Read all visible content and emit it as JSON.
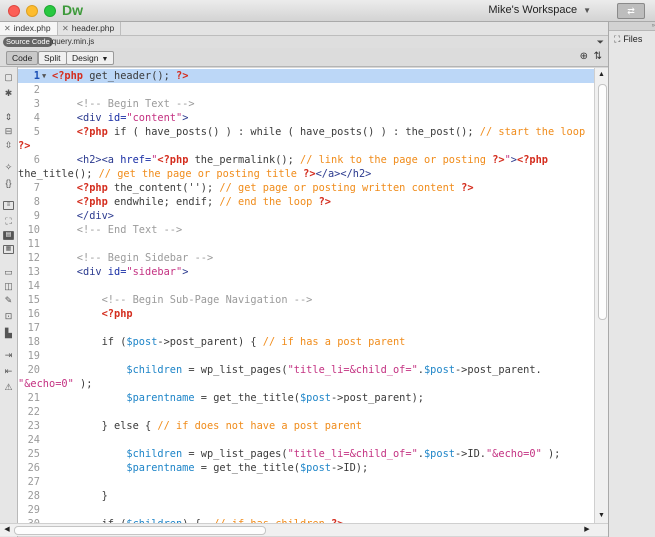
{
  "app": {
    "logo": "Dw",
    "workspace": "Mike's Workspace",
    "workspace_btn": "⇄"
  },
  "tabs": [
    {
      "label": "index.php",
      "active": true
    },
    {
      "label": "header.php",
      "active": false
    }
  ],
  "related": {
    "source_label": "Source Code",
    "file": "jquery.min.js"
  },
  "modes": {
    "code": "Code",
    "split": "Split",
    "design": "Design"
  },
  "panel": {
    "files": "Files"
  },
  "colors": {
    "php_tag": "#d42d1e",
    "comment": "#f08c1b",
    "html_comment": "#9b9b9b",
    "tag": "#2b3a8f",
    "string": "#c43282",
    "variable": "#1e85c8",
    "selection": "#bcd7f7"
  },
  "code_lines": [
    {
      "n": "1",
      "cur": true,
      "fold": "▼",
      "parts": [
        [
          "k",
          "<?php "
        ],
        [
          "f",
          "get_header(); "
        ],
        [
          "k",
          "?>"
        ]
      ]
    },
    {
      "n": "2",
      "parts": []
    },
    {
      "n": "3",
      "parts": [
        [
          "h",
          "    <!-- Begin Text -->"
        ]
      ]
    },
    {
      "n": "4",
      "parts": [
        [
          "t",
          "    <div "
        ],
        [
          "a",
          "id="
        ],
        [
          "st",
          "\"content\""
        ],
        [
          "t",
          ">"
        ]
      ]
    },
    {
      "n": "5",
      "parts": [
        [
          "k",
          "    <?php "
        ],
        [
          "f",
          "if ( have_posts() ) : while ( have_posts() ) : the_post(); "
        ],
        [
          "c",
          "// start the loop"
        ]
      ]
    },
    {
      "n": "",
      "wrap": true,
      "parts": [
        [
          "k",
          "?>"
        ]
      ]
    },
    {
      "n": "6",
      "parts": [
        [
          "t",
          "    <h2><a "
        ],
        [
          "a",
          "href="
        ],
        [
          "st",
          "\""
        ],
        [
          "k",
          "<?php "
        ],
        [
          "f",
          "the_permalink(); "
        ],
        [
          "c",
          "// link to the page or posting "
        ],
        [
          "k",
          "?>"
        ],
        [
          "st",
          "\""
        ],
        [
          "t",
          ">"
        ],
        [
          "k",
          "<?php"
        ]
      ]
    },
    {
      "n": "",
      "wrap": true,
      "parts": [
        [
          "f",
          "the_title(); "
        ],
        [
          "c",
          "// get the page or posting title "
        ],
        [
          "k",
          "?>"
        ],
        [
          "t",
          "</a></h2>"
        ]
      ]
    },
    {
      "n": "7",
      "parts": [
        [
          "k",
          "    <?php "
        ],
        [
          "f",
          "the_content(''); "
        ],
        [
          "c",
          "// get page or posting written content "
        ],
        [
          "k",
          "?>"
        ]
      ]
    },
    {
      "n": "8",
      "parts": [
        [
          "k",
          "    <?php "
        ],
        [
          "f",
          "endwhile; endif; "
        ],
        [
          "c",
          "// end the loop "
        ],
        [
          "k",
          "?>"
        ]
      ]
    },
    {
      "n": "9",
      "parts": [
        [
          "t",
          "    </div>"
        ]
      ]
    },
    {
      "n": "10",
      "parts": [
        [
          "h",
          "    <!-- End Text -->"
        ]
      ]
    },
    {
      "n": "11",
      "parts": []
    },
    {
      "n": "12",
      "parts": [
        [
          "h",
          "    <!-- Begin Sidebar -->"
        ]
      ]
    },
    {
      "n": "13",
      "parts": [
        [
          "t",
          "    <div "
        ],
        [
          "a",
          "id="
        ],
        [
          "st",
          "\"sidebar\""
        ],
        [
          "t",
          ">"
        ]
      ]
    },
    {
      "n": "14",
      "parts": []
    },
    {
      "n": "15",
      "parts": [
        [
          "h",
          "        <!-- Begin Sub-Page Navigation -->"
        ]
      ]
    },
    {
      "n": "16",
      "parts": [
        [
          "k",
          "        <?php"
        ]
      ]
    },
    {
      "n": "17",
      "parts": []
    },
    {
      "n": "18",
      "parts": [
        [
          "f",
          "        if ("
        ],
        [
          "v",
          "$post"
        ],
        [
          "f",
          "->post_parent) { "
        ],
        [
          "c",
          "// if has a post parent"
        ]
      ]
    },
    {
      "n": "19",
      "parts": []
    },
    {
      "n": "20",
      "parts": [
        [
          "v",
          "            $children"
        ],
        [
          "f",
          " = wp_list_pages("
        ],
        [
          "st",
          "\"title_li=&child_of=\""
        ],
        [
          "f",
          "."
        ],
        [
          "v",
          "$post"
        ],
        [
          "f",
          "->post_parent."
        ]
      ]
    },
    {
      "n": "",
      "wrap": true,
      "parts": [
        [
          "st",
          "\"&echo=0\""
        ],
        [
          "f",
          " );"
        ]
      ]
    },
    {
      "n": "21",
      "parts": [
        [
          "v",
          "            $parentname"
        ],
        [
          "f",
          " = get_the_title("
        ],
        [
          "v",
          "$post"
        ],
        [
          "f",
          "->post_parent);"
        ]
      ]
    },
    {
      "n": "22",
      "parts": []
    },
    {
      "n": "23",
      "parts": [
        [
          "f",
          "        } else { "
        ],
        [
          "c",
          "// if does not have a post parent"
        ]
      ]
    },
    {
      "n": "24",
      "parts": []
    },
    {
      "n": "25",
      "parts": [
        [
          "v",
          "            $children"
        ],
        [
          "f",
          " = wp_list_pages("
        ],
        [
          "st",
          "\"title_li=&child_of=\""
        ],
        [
          "f",
          "."
        ],
        [
          "v",
          "$post"
        ],
        [
          "f",
          "->ID."
        ],
        [
          "st",
          "\"&echo=0\""
        ],
        [
          "f",
          " );"
        ]
      ]
    },
    {
      "n": "26",
      "parts": [
        [
          "v",
          "            $parentname"
        ],
        [
          "f",
          " = get_the_title("
        ],
        [
          "v",
          "$post"
        ],
        [
          "f",
          "->ID);"
        ]
      ]
    },
    {
      "n": "27",
      "parts": []
    },
    {
      "n": "28",
      "parts": [
        [
          "f",
          "        }"
        ]
      ]
    },
    {
      "n": "29",
      "parts": []
    },
    {
      "n": "30",
      "parts": [
        [
          "f",
          "        if ("
        ],
        [
          "v",
          "$children"
        ],
        [
          "f",
          ") {  "
        ],
        [
          "c",
          "// if has children "
        ],
        [
          "k",
          "?>"
        ]
      ]
    }
  ]
}
